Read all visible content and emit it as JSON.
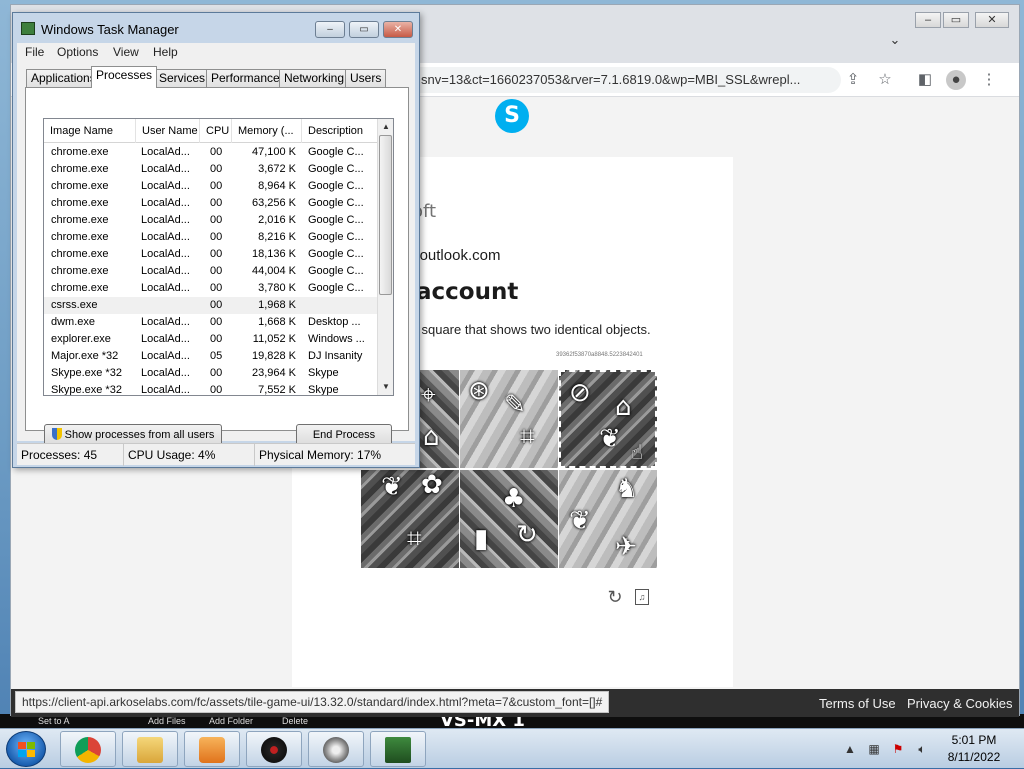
{
  "browser": {
    "url": "snv=13&ct=1660237053&rver=7.1.6819.0&wp=MBI_SSL&wrepl...",
    "status_url": "https://client-api.arkoselabs.com/fc/assets/tile-game-ui/13.32.0/standard/index.html?meta=7&custom_font=[]#",
    "footer_links": [
      "Terms of Use",
      "Privacy & Cookies"
    ]
  },
  "signin": {
    "brand": "oft",
    "email": "h@outlook.com",
    "heading": "account",
    "prompt": "he square that shows two identical objects.",
    "session_id": "39362f53870a8848.5223842401"
  },
  "desktop_strip": {
    "labels": [
      "Set to A",
      "Add Files",
      "Add Folder",
      "Delete"
    ],
    "big_text": "VS-MX 1"
  },
  "task_manager": {
    "title": "Windows Task Manager",
    "menu": [
      "File",
      "Options",
      "View",
      "Help"
    ],
    "tabs": [
      "Applications",
      "Processes",
      "Services",
      "Performance",
      "Networking",
      "Users"
    ],
    "active_tab": "Processes",
    "columns": [
      "Image Name",
      "User Name",
      "CPU",
      "Memory (...",
      "Description"
    ],
    "rows": [
      [
        "chrome.exe",
        "LocalAd...",
        "00",
        "47,100 K",
        "Google C..."
      ],
      [
        "chrome.exe",
        "LocalAd...",
        "00",
        "3,672 K",
        "Google C..."
      ],
      [
        "chrome.exe",
        "LocalAd...",
        "00",
        "8,964 K",
        "Google C..."
      ],
      [
        "chrome.exe",
        "LocalAd...",
        "00",
        "63,256 K",
        "Google C..."
      ],
      [
        "chrome.exe",
        "LocalAd...",
        "00",
        "2,016 K",
        "Google C..."
      ],
      [
        "chrome.exe",
        "LocalAd...",
        "00",
        "8,216 K",
        "Google C..."
      ],
      [
        "chrome.exe",
        "LocalAd...",
        "00",
        "18,136 K",
        "Google C..."
      ],
      [
        "chrome.exe",
        "LocalAd...",
        "00",
        "44,004 K",
        "Google C..."
      ],
      [
        "chrome.exe",
        "LocalAd...",
        "00",
        "3,780 K",
        "Google C..."
      ],
      [
        "csrss.exe",
        "",
        "00",
        "1,968 K",
        ""
      ],
      [
        "dwm.exe",
        "LocalAd...",
        "00",
        "1,668 K",
        "Desktop ..."
      ],
      [
        "explorer.exe",
        "LocalAd...",
        "00",
        "11,052 K",
        "Windows ..."
      ],
      [
        "Major.exe *32",
        "LocalAd...",
        "05",
        "19,828 K",
        "DJ Insanity"
      ],
      [
        "Skype.exe *32",
        "LocalAd...",
        "00",
        "23,964 K",
        "Skype"
      ],
      [
        "Skype.exe *32",
        "LocalAd...",
        "00",
        "7,552 K",
        "Skype"
      ]
    ],
    "show_all_label": "Show processes from all users",
    "end_process_label": "End Process",
    "status": {
      "processes": "Processes: 45",
      "cpu": "CPU Usage: 4%",
      "memory": "Physical Memory: 17%"
    }
  },
  "taskbar": {
    "time": "5:01 PM",
    "date": "8/11/2022"
  },
  "colors": {
    "skype_blue": "#00aff0",
    "footer_bg": "#2f2f2f"
  }
}
